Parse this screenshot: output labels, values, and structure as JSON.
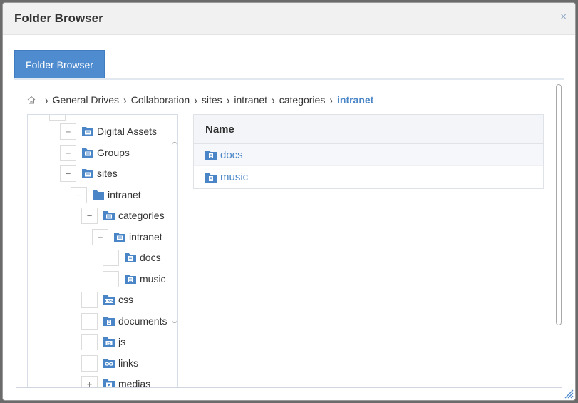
{
  "dialog": {
    "title": "Folder Browser",
    "close_label": "×"
  },
  "tabs": [
    {
      "label": "Folder Browser",
      "active": true
    }
  ],
  "breadcrumb": {
    "home_icon": "home-icon",
    "separator": "›",
    "items": [
      {
        "label": "General Drives"
      },
      {
        "label": "Collaboration"
      },
      {
        "label": "sites"
      },
      {
        "label": "intranet"
      },
      {
        "label": "categories"
      },
      {
        "label": "intranet",
        "active": true
      }
    ]
  },
  "tree": {
    "nodes": [
      {
        "label": "Digital Assets",
        "toggle": "+",
        "icon": "folder-drive-icon"
      },
      {
        "label": "Groups",
        "toggle": "+",
        "icon": "folder-drive-icon"
      },
      {
        "label": "sites",
        "toggle": "−",
        "icon": "folder-drive-icon"
      },
      {
        "label": "intranet",
        "toggle": "−",
        "icon": "folder-solid-icon"
      },
      {
        "label": "categories",
        "toggle": "−",
        "icon": "folder-drive-icon"
      },
      {
        "label": "intranet",
        "toggle": "+",
        "icon": "folder-drive-icon"
      },
      {
        "label": "docs",
        "toggle": "",
        "icon": "folder-doc-icon"
      },
      {
        "label": "music",
        "toggle": "",
        "icon": "folder-doc-icon"
      },
      {
        "label": "css",
        "toggle": "",
        "icon": "folder-css-icon"
      },
      {
        "label": "documents",
        "toggle": "",
        "icon": "folder-doc-icon"
      },
      {
        "label": "js",
        "toggle": "",
        "icon": "folder-js-icon"
      },
      {
        "label": "links",
        "toggle": "",
        "icon": "folder-link-icon"
      },
      {
        "label": "medias",
        "toggle": "+",
        "icon": "folder-media-icon"
      }
    ]
  },
  "table": {
    "header": "Name",
    "rows": [
      {
        "label": "docs",
        "icon": "folder-doc-icon"
      },
      {
        "label": "music",
        "icon": "folder-doc-icon"
      }
    ]
  },
  "colors": {
    "accent": "#4f8bcf",
    "link": "#4a86c7",
    "folder": "#4a86c7"
  }
}
